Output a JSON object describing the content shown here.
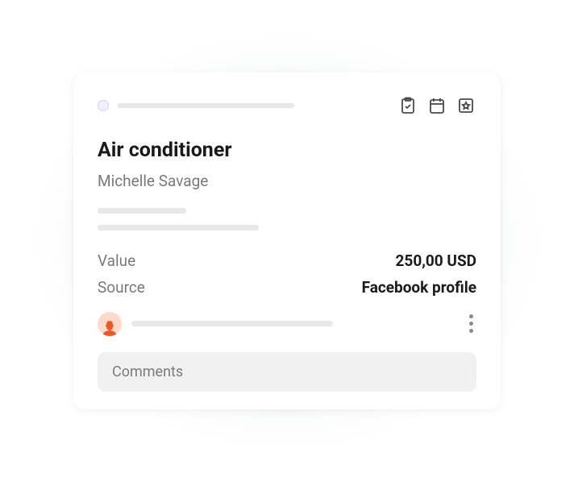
{
  "card": {
    "title": "Air conditioner",
    "person": "Michelle Savage",
    "fields": {
      "value": {
        "label": "Value",
        "amount": "250,00 USD"
      },
      "source": {
        "label": "Source",
        "text": "Facebook profile"
      }
    },
    "comments": {
      "placeholder": "Comments"
    }
  },
  "icons": {
    "clipboard": "clipboard-check-icon",
    "calendar": "calendar-icon",
    "star": "star-icon",
    "more": "more-vertical-icon"
  }
}
